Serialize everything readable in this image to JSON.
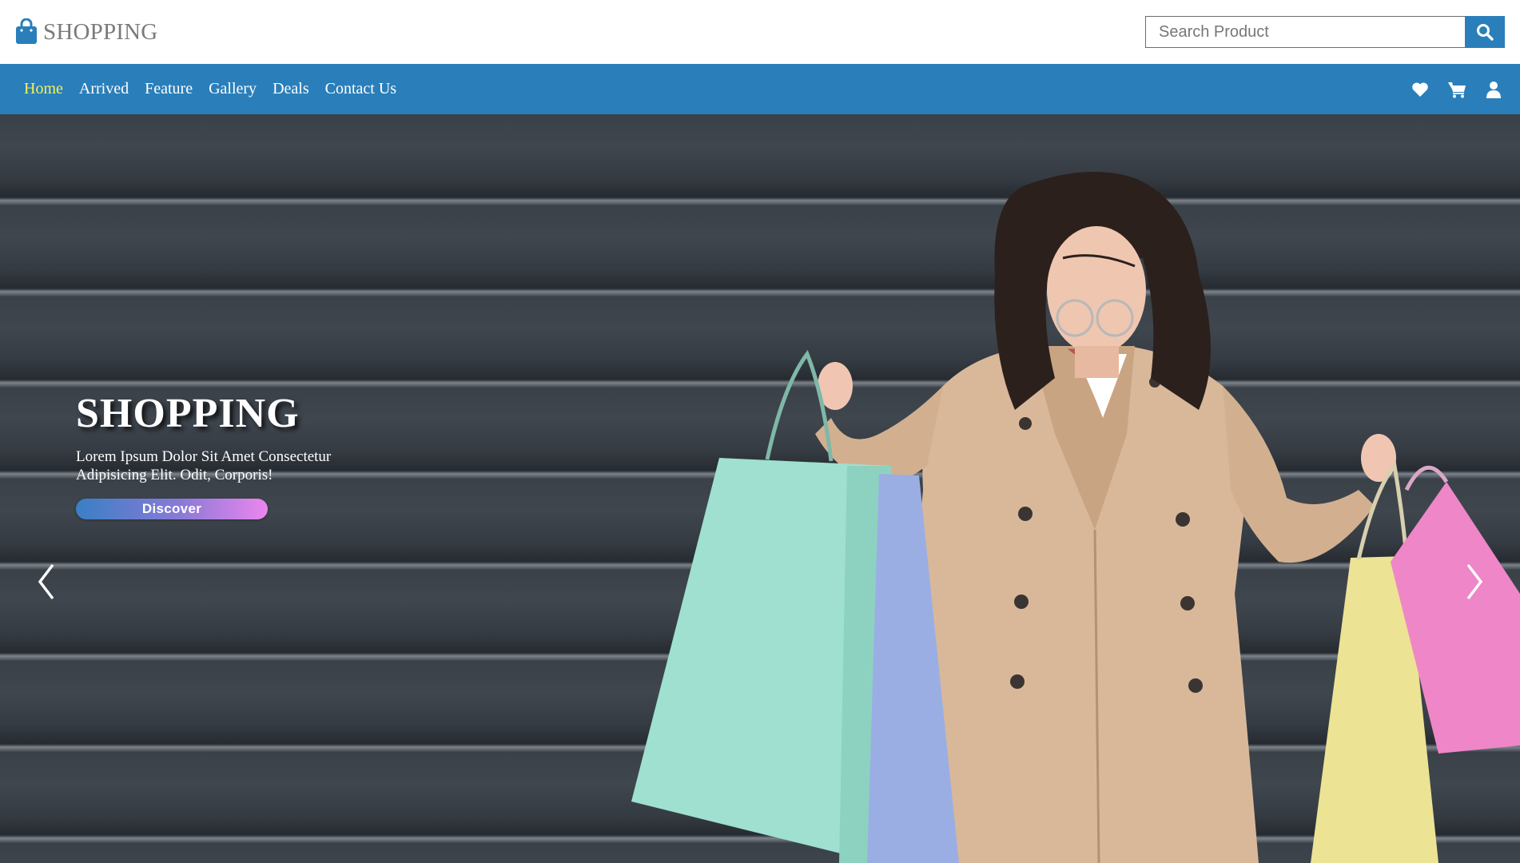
{
  "header": {
    "logo_text": "SHOPPING",
    "logo_icon": "shopping-bag-icon",
    "search": {
      "placeholder": "Search Product",
      "value": "",
      "button_icon": "search-icon"
    }
  },
  "nav": {
    "links": [
      {
        "label": "Home",
        "active": true
      },
      {
        "label": "Arrived",
        "active": false
      },
      {
        "label": "Feature",
        "active": false
      },
      {
        "label": "Gallery",
        "active": false
      },
      {
        "label": "Deals",
        "active": false
      },
      {
        "label": "Contact Us",
        "active": false
      }
    ],
    "icons": [
      "heart-icon",
      "cart-icon",
      "user-icon"
    ]
  },
  "hero": {
    "title": "SHOPPING",
    "subtitle": "Lorem Ipsum Dolor Sit Amet Consectetur Adipisicing Elit. Odit, Corporis!",
    "button_label": "Discover",
    "prev_arrow": "❮",
    "next_arrow": "❯"
  },
  "colors": {
    "brand_blue": "#2a7fba",
    "active_nav": "#f6f05a",
    "logo_text": "#7a7a7a",
    "button_gradient_start": "#3a7fc4",
    "button_gradient_end": "#ec86ee"
  }
}
